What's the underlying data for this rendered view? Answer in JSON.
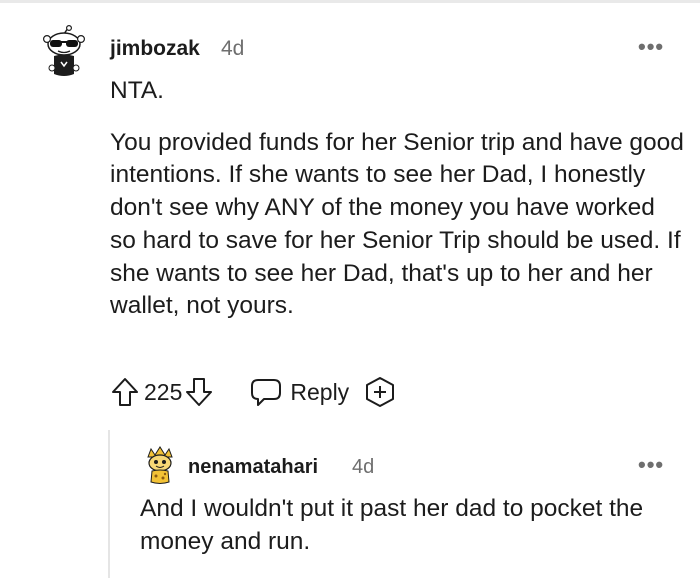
{
  "comment": {
    "username": "jimbozak",
    "timestamp": "4d",
    "paragraphs": [
      "NTA.",
      "You provided funds for her Senior trip and have good intentions. If she wants to see her Dad, I honestly don't see why ANY of the money you have worked so hard to save for her Senior Trip should be used. If she wants to see her Dad, that's up to her and her wallet, not yours."
    ],
    "vote_count": "225",
    "reply_label": "Reply",
    "more_label": "•••",
    "icons": [
      "upvote-icon",
      "downvote-icon",
      "reply-icon",
      "add-award-icon"
    ]
  },
  "reply": {
    "username": "nenamatahari",
    "timestamp": "4d",
    "text": "And I wouldn't put it past her dad to pocket the money and run.",
    "more_label": "•••"
  },
  "colors": {
    "text": "#1c1c1c",
    "meta": "#6e6e6e",
    "thread_line": "#e5e5e5"
  }
}
